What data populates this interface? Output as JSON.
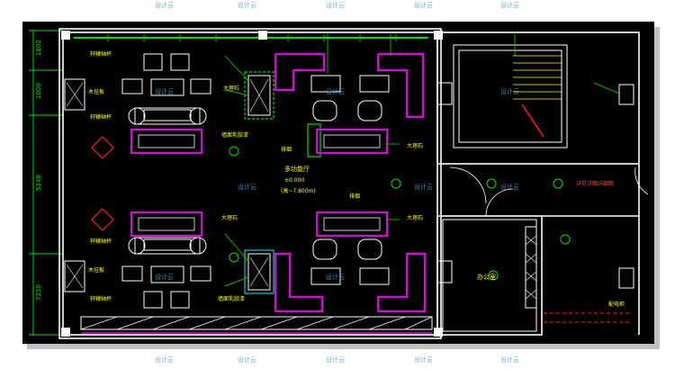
{
  "colors": {
    "background": "#000000",
    "wall": "#ffffff",
    "green": "#00e000",
    "magenta": "#e000e0",
    "yellow": "#ffff00",
    "red": "#ff2020",
    "cyan": "#00d0d0",
    "watermark": "#4aa0d8"
  },
  "dimensions_left": [
    "1802",
    "1000",
    "5248",
    "7250"
  ],
  "labels": {
    "rooms": [
      "多功能厅",
      "办公室"
    ],
    "elevation": "±0.000",
    "ceiling": "(高~7.800m)",
    "logo": "排烟",
    "cabinet": "木挂板",
    "right_text": "详见详图详细图",
    "bottom_right": "配电柜"
  },
  "tag_texts": [
    "轩辕轴杯",
    "木挂板",
    "大理石",
    "墙面乳胶漆",
    "木挂板",
    "排烟"
  ],
  "watermark": "设计云"
}
